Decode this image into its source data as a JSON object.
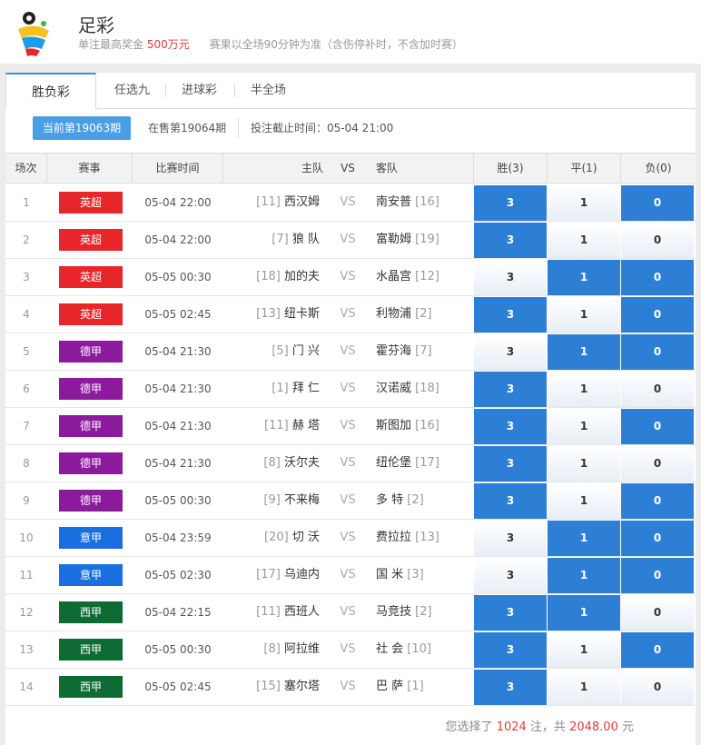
{
  "header": {
    "title": "足彩",
    "prize_label": "单注最高奖金",
    "prize_value": "500万元",
    "rule": "赛果以全场90分钟为准（含伤停补时，不含加时赛）"
  },
  "tabs": [
    "胜负彩",
    "任选九",
    "进球彩",
    "半全场"
  ],
  "issue": {
    "current": "当前第19063期",
    "next": "在售第19064期",
    "deadline": "投注截止时间：05-04 21:00"
  },
  "columns": [
    "场次",
    "赛事",
    "比赛时间",
    "主队",
    "VS",
    "客队",
    "胜(3)",
    "平(1)",
    "负(0)"
  ],
  "colors": {
    "英超": "#e8262a",
    "德甲": "#8b1a9c",
    "意甲": "#1a6fe0",
    "西甲": "#0e6b34",
    "selected": "#2d7fd6"
  },
  "matches": [
    {
      "no": "1",
      "league": "英超",
      "time": "05-04 22:00",
      "home_rank": "[11]",
      "home": "西汉姆",
      "vs": "VS",
      "away": "南安普",
      "away_rank": "[16]",
      "o3": "3",
      "o1": "1",
      "o0": "0",
      "sel": [
        1,
        0,
        1
      ]
    },
    {
      "no": "2",
      "league": "英超",
      "time": "05-04 22:00",
      "home_rank": "[7]",
      "home": "狼 队",
      "vs": "VS",
      "away": "富勒姆",
      "away_rank": "[19]",
      "o3": "3",
      "o1": "1",
      "o0": "0",
      "sel": [
        1,
        0,
        0
      ]
    },
    {
      "no": "3",
      "league": "英超",
      "time": "05-05 00:30",
      "home_rank": "[18]",
      "home": "加的夫",
      "vs": "VS",
      "away": "水晶宫",
      "away_rank": "[12]",
      "o3": "3",
      "o1": "1",
      "o0": "0",
      "sel": [
        0,
        1,
        1
      ]
    },
    {
      "no": "4",
      "league": "英超",
      "time": "05-05 02:45",
      "home_rank": "[13]",
      "home": "纽卡斯",
      "vs": "VS",
      "away": "利物浦",
      "away_rank": "[2]",
      "o3": "3",
      "o1": "1",
      "o0": "0",
      "sel": [
        1,
        0,
        1
      ]
    },
    {
      "no": "5",
      "league": "德甲",
      "time": "05-04 21:30",
      "home_rank": "[5]",
      "home": "门 兴",
      "vs": "VS",
      "away": "霍芬海",
      "away_rank": "[7]",
      "o3": "3",
      "o1": "1",
      "o0": "0",
      "sel": [
        0,
        1,
        1
      ]
    },
    {
      "no": "6",
      "league": "德甲",
      "time": "05-04 21:30",
      "home_rank": "[1]",
      "home": "拜 仁",
      "vs": "VS",
      "away": "汉诺威",
      "away_rank": "[18]",
      "o3": "3",
      "o1": "1",
      "o0": "0",
      "sel": [
        1,
        0,
        0
      ]
    },
    {
      "no": "7",
      "league": "德甲",
      "time": "05-04 21:30",
      "home_rank": "[11]",
      "home": "赫 塔",
      "vs": "VS",
      "away": "斯图加",
      "away_rank": "[16]",
      "o3": "3",
      "o1": "1",
      "o0": "0",
      "sel": [
        1,
        0,
        1
      ]
    },
    {
      "no": "8",
      "league": "德甲",
      "time": "05-04 21:30",
      "home_rank": "[8]",
      "home": "沃尔夫",
      "vs": "VS",
      "away": "纽伦堡",
      "away_rank": "[17]",
      "o3": "3",
      "o1": "1",
      "o0": "0",
      "sel": [
        1,
        0,
        0
      ]
    },
    {
      "no": "9",
      "league": "德甲",
      "time": "05-05 00:30",
      "home_rank": "[9]",
      "home": "不来梅",
      "vs": "VS",
      "away": "多 特",
      "away_rank": "[2]",
      "o3": "3",
      "o1": "1",
      "o0": "0",
      "sel": [
        1,
        0,
        1
      ]
    },
    {
      "no": "10",
      "league": "意甲",
      "time": "05-04 23:59",
      "home_rank": "[20]",
      "home": "切 沃",
      "vs": "VS",
      "away": "费拉拉",
      "away_rank": "[13]",
      "o3": "3",
      "o1": "1",
      "o0": "0",
      "sel": [
        0,
        1,
        1
      ]
    },
    {
      "no": "11",
      "league": "意甲",
      "time": "05-05 02:30",
      "home_rank": "[17]",
      "home": "乌迪内",
      "vs": "VS",
      "away": "国 米",
      "away_rank": "[3]",
      "o3": "3",
      "o1": "1",
      "o0": "0",
      "sel": [
        0,
        1,
        1
      ]
    },
    {
      "no": "12",
      "league": "西甲",
      "time": "05-04 22:15",
      "home_rank": "[11]",
      "home": "西班人",
      "vs": "VS",
      "away": "马竞技",
      "away_rank": "[2]",
      "o3": "3",
      "o1": "1",
      "o0": "0",
      "sel": [
        1,
        1,
        0
      ]
    },
    {
      "no": "13",
      "league": "西甲",
      "time": "05-05 00:30",
      "home_rank": "[8]",
      "home": "阿拉维",
      "vs": "VS",
      "away": "社 会",
      "away_rank": "[10]",
      "o3": "3",
      "o1": "1",
      "o0": "0",
      "sel": [
        1,
        0,
        1
      ]
    },
    {
      "no": "14",
      "league": "西甲",
      "time": "05-05 02:45",
      "home_rank": "[15]",
      "home": "塞尔塔",
      "vs": "VS",
      "away": "巴 萨",
      "away_rank": "[1]",
      "o3": "3",
      "o1": "1",
      "o0": "0",
      "sel": [
        1,
        0,
        0
      ]
    }
  ],
  "summary": {
    "prefix": "您选择了",
    "bets": "1024",
    "mid": "注，共",
    "amount": "2048.00",
    "suffix": "元"
  }
}
